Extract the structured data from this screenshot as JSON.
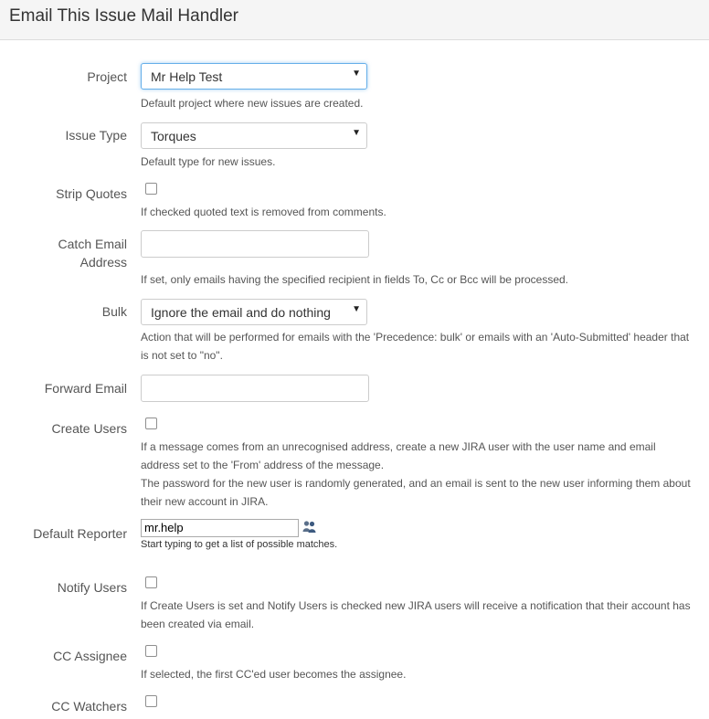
{
  "title": "Email This Issue Mail Handler",
  "project": {
    "label": "Project",
    "value": "Mr Help Test",
    "help": "Default project where new issues are created."
  },
  "issue_type": {
    "label": "Issue Type",
    "value": "Torques",
    "help": "Default type for new issues."
  },
  "strip_quotes": {
    "label": "Strip Quotes",
    "checked": false,
    "help": "If checked quoted text is removed from comments."
  },
  "catch_email": {
    "label_line1": "Catch Email",
    "label_line2": "Address",
    "value": "",
    "help": "If set, only emails having the specified recipient in fields To, Cc or Bcc will be processed."
  },
  "bulk": {
    "label": "Bulk",
    "value": "Ignore the email and do nothing",
    "help_line1": "Action that will be performed for emails with the 'Precedence: bulk' or emails with an 'Auto-Submitted' header that",
    "help_line2": "is not set to \"no\"."
  },
  "forward_email": {
    "label": "Forward Email",
    "value": ""
  },
  "create_users": {
    "label": "Create Users",
    "checked": false,
    "help_line1": "If a message comes from an unrecognised address, create a new JIRA user with the user name and email",
    "help_line2": "address set to the 'From' address of the message.",
    "help_line3": "The password for the new user is randomly generated, and an email is sent to the new user informing them about",
    "help_line4": "their new account in JIRA."
  },
  "default_reporter": {
    "label": "Default Reporter",
    "value": "mr.help",
    "hint": "Start typing to get a list of possible matches.",
    "icon": "user-picker-icon"
  },
  "notify_users": {
    "label": "Notify Users",
    "checked": false,
    "help_line1": "If Create Users is set and Notify Users is checked new JIRA users will receive a notification that their account has",
    "help_line2": "been created via email."
  },
  "cc_assignee": {
    "label": "CC Assignee",
    "checked": false,
    "help": "If selected, the first CC'ed user becomes the assignee."
  },
  "cc_watchers": {
    "label": "CC Watchers",
    "checked": false
  },
  "dropdown_arrow": "▼",
  "colors": {
    "header_bg": "#f5f5f5",
    "focus_border": "#66afe9",
    "text": "#333333",
    "help_text": "#555555"
  }
}
